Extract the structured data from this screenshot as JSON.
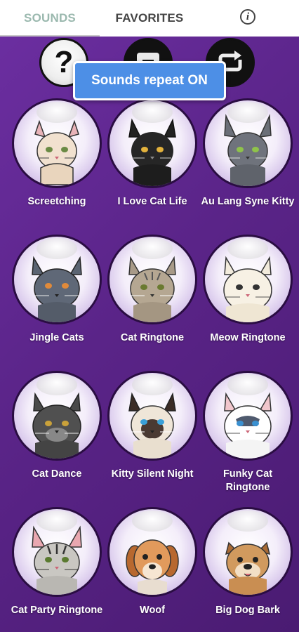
{
  "tabs": {
    "sounds_label": "SOUNDS",
    "favorites_label": "FAVORITES",
    "info_glyph": "i"
  },
  "controls": {
    "help_glyph": "?",
    "toast": "Sounds repeat ON"
  },
  "colors": {
    "accent": "#4d8fe6",
    "background": "#5a2486",
    "active_tab": "#9ab8ae"
  },
  "sounds": [
    {
      "label": "Screetching",
      "icon": "cream-cat-icon"
    },
    {
      "label": "I Love Cat Life",
      "icon": "black-cat-icon"
    },
    {
      "label": "Au Lang Syne Kitty",
      "icon": "gray-cat-icon"
    },
    {
      "label": "Jingle Cats",
      "icon": "blue-gray-cat-icon"
    },
    {
      "label": "Cat Ringtone",
      "icon": "tabby-cat-icon"
    },
    {
      "label": "Meow Ringtone",
      "icon": "fluffy-white-cat-icon"
    },
    {
      "label": "Cat Dance",
      "icon": "dark-fluffy-cat-icon"
    },
    {
      "label": "Kitty Silent Night",
      "icon": "siamese-cat-icon"
    },
    {
      "label": "Funky Cat Ringtone",
      "icon": "ragdoll-cat-icon"
    },
    {
      "label": "Cat Party Ringtone",
      "icon": "striped-cat-icon"
    },
    {
      "label": "Woof",
      "icon": "beagle-dog-icon"
    },
    {
      "label": "Big Dog Bark",
      "icon": "bulldog-icon"
    }
  ]
}
